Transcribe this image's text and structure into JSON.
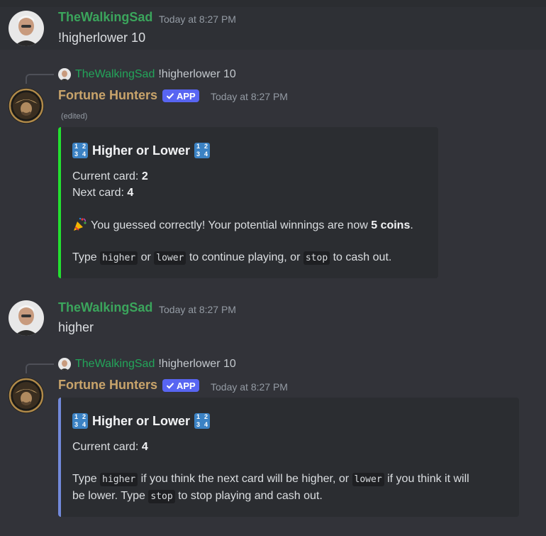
{
  "messages": [
    {
      "author": "TheWalkingSad",
      "timestamp": "Today at 8:27 PM",
      "content": "!higherlower 10"
    },
    {
      "reply": {
        "author": "TheWalkingSad",
        "text": "!higherlower 10"
      },
      "author": "Fortune Hunters",
      "badge": "APP",
      "timestamp": "Today at 8:27 PM",
      "edited": "(edited)",
      "embed": {
        "accent": "#23e030",
        "title": "Higher or Lower",
        "current_label": "Current card:",
        "current_value": "2",
        "next_label": "Next card:",
        "next_value": "4",
        "result_text": "You guessed correctly! Your potential winnings are now ",
        "result_amount": "5 coins",
        "result_end": ".",
        "type_word": "Type",
        "cmd_higher": "higher",
        "or_word": "or",
        "cmd_lower": "lower",
        "continue_text": "to continue playing, or",
        "cmd_stop": "stop",
        "cashout_text": "to cash out."
      }
    },
    {
      "author": "TheWalkingSad",
      "timestamp": "Today at 8:27 PM",
      "content": "higher"
    },
    {
      "reply": {
        "author": "TheWalkingSad",
        "text": "!higherlower 10"
      },
      "author": "Fortune Hunters",
      "badge": "APP",
      "timestamp": "Today at 8:27 PM",
      "embed": {
        "accent": "#7289da",
        "title": "Higher or Lower",
        "current_label": "Current card:",
        "current_value": "4",
        "type_word": "Type",
        "cmd_higher": "higher",
        "text_a": "if you think the next card will be higher, or",
        "cmd_lower": "lower",
        "text_b": "if you think it will",
        "text_c": "be lower. Type",
        "cmd_stop": "stop",
        "text_d": "to stop playing and cash out."
      }
    }
  ],
  "colors": {
    "user_name": "#3ba55c",
    "bot_name": "#c9a46b",
    "app_badge": "#5865f2"
  },
  "icons": [
    "user-avatar",
    "bot-avatar",
    "checkmark-icon",
    "numbers-icon",
    "party-popper-icon"
  ]
}
